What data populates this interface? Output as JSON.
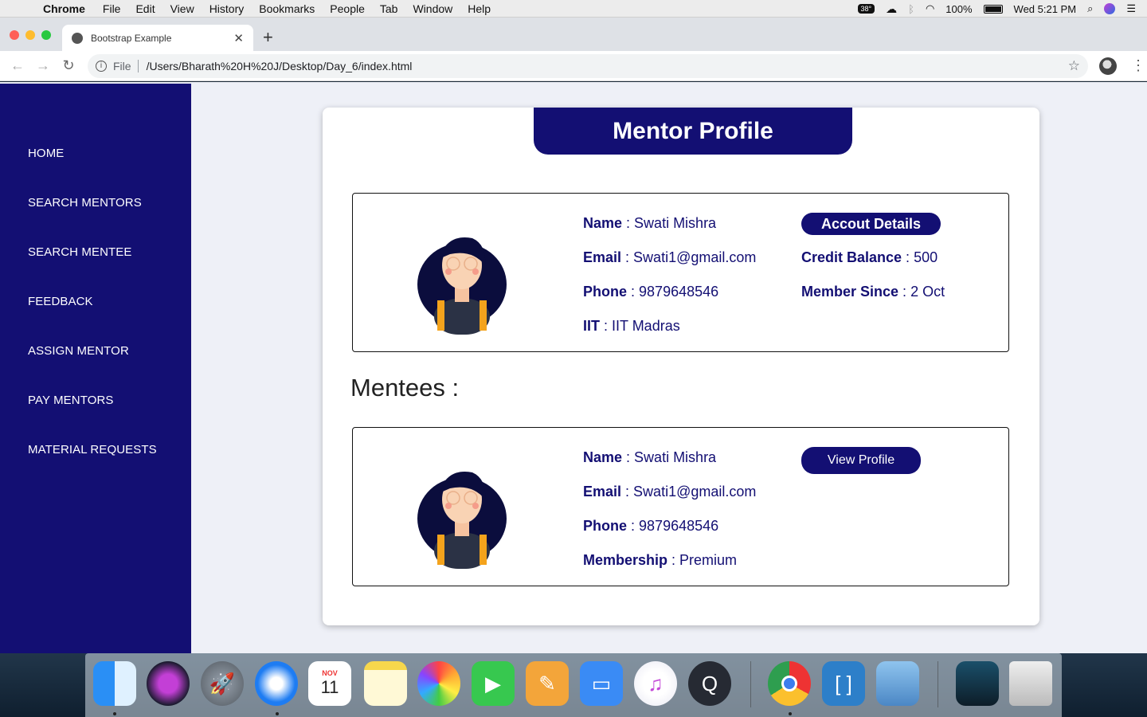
{
  "menubar": {
    "app": "Chrome",
    "items": [
      "File",
      "Edit",
      "View",
      "History",
      "Bookmarks",
      "People",
      "Tab",
      "Window",
      "Help"
    ],
    "temperature": "38°",
    "battery": "100%",
    "clock": "Wed 5:21 PM"
  },
  "browser": {
    "tab_title": "Bootstrap Example",
    "url_scheme": "File",
    "url": "/Users/Bharath%20H%20J/Desktop/Day_6/index.html"
  },
  "sidebar": {
    "items": [
      "HOME",
      "SEARCH MENTORS",
      "SEARCH MENTEE",
      "FEEDBACK",
      "ASSIGN MENTOR",
      "PAY MENTORS",
      "MATERIAL REQUESTS"
    ]
  },
  "profile": {
    "header": "Mentor Profile",
    "name_label": "Name",
    "name": "Swati Mishra",
    "email_label": "Email",
    "email": "Swati1@gmail.com",
    "phone_label": "Phone",
    "phone": "9879648546",
    "iit_label": "IIT",
    "iit": "IIT Madras",
    "account_button": "Accout Details",
    "credit_label": "Credit Balance",
    "credit": "500",
    "member_label": "Member Since",
    "member_since": "2 Oct"
  },
  "mentees": {
    "title": "Mentees :",
    "list": [
      {
        "name_label": "Name",
        "name": "Swati Mishra",
        "email_label": "Email",
        "email": "Swati1@gmail.com",
        "phone_label": "Phone",
        "phone": "9879648546",
        "membership_label": "Membership",
        "membership": "Premium",
        "button": "View Profile"
      }
    ]
  },
  "dock": {
    "apps": [
      "finder-icon",
      "siri-icon",
      "launchpad-icon",
      "safari-icon",
      "calendar-icon",
      "notes-icon",
      "photos-icon",
      "facetime-icon",
      "pages-icon",
      "keynote-icon",
      "itunes-icon",
      "quicktime-icon",
      "chrome-icon",
      "brackets-icon",
      "preview-icon",
      "book-icon",
      "trash-icon"
    ],
    "calendar_month": "NOV",
    "calendar_day": "11"
  },
  "colors": {
    "brand": "#130f73",
    "page_bg": "#eef0f7"
  }
}
